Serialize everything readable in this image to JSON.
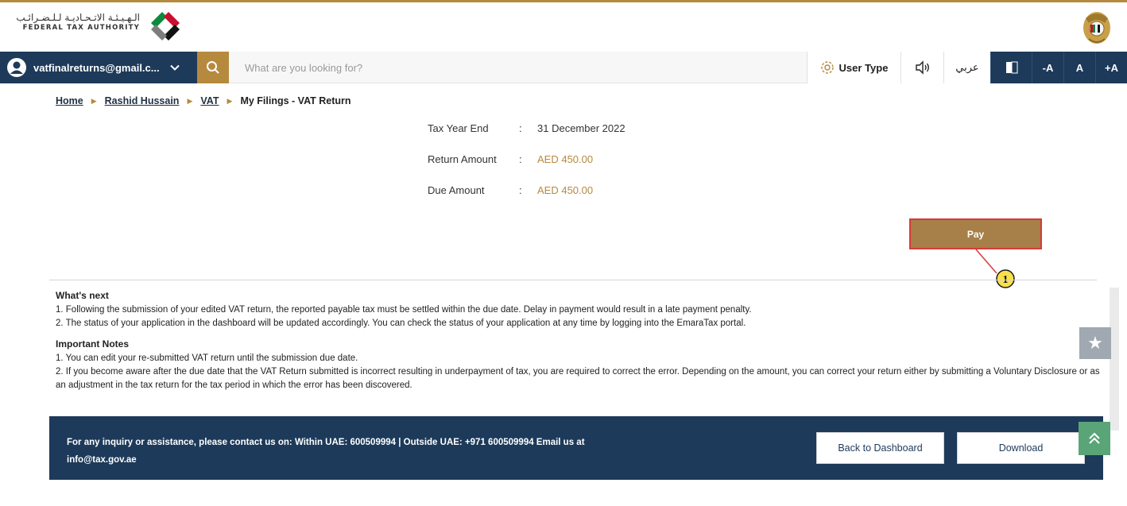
{
  "header": {
    "logo_arabic": "الـهـيـئـة الاتـحـاديـة لـلـضـرائـب",
    "logo_english": "FEDERAL TAX AUTHORITY",
    "emblem_icon": "uae-emblem-icon"
  },
  "navbar": {
    "user_email": "vatfinalreturns@gmail.c...",
    "search_placeholder": "What are you looking for?",
    "user_type_label": "User Type",
    "arabic_label": "عربي",
    "font_decrease": "-A",
    "font_normal": "A",
    "font_increase": "+A"
  },
  "breadcrumb": {
    "items": [
      "Home",
      "Rashid Hussain",
      "VAT"
    ],
    "current": "My Filings - VAT Return"
  },
  "summary": {
    "rows": [
      {
        "label": "Tax Year End",
        "colon": ":",
        "value": "31 December 2022"
      },
      {
        "label": "Return Amount",
        "colon": ":",
        "value": "AED 450.00"
      },
      {
        "label": "Due Amount",
        "colon": ":",
        "value": "AED 450.00"
      }
    ]
  },
  "pay": {
    "label": "Pay",
    "callout_number": "1"
  },
  "whats_next": {
    "title": "What's next",
    "items": [
      "1. Following the submission of your edited VAT return, the reported payable tax must be settled within the due date. Delay in payment would result in a late payment penalty.",
      "2. The status of your application in the dashboard will be updated accordingly. You can check the status of your application at any time by logging into the EmaraTax portal."
    ]
  },
  "important_notes": {
    "title": "Important Notes",
    "items": [
      "1. You can edit your re-submitted VAT return until the submission due date.",
      "2. If you become aware after the due date that the VAT Return submitted is incorrect resulting in underpayment of tax, you are required to correct the error. Depending on the amount, you can correct your return either by submitting a Voluntary Disclosure or as an adjustment in the tax return for the tax period in which the error has been discovered."
    ]
  },
  "footer": {
    "contact_line1": "For any inquiry or assistance, please contact us on: Within UAE: 600509994 | Outside UAE: +971 600509994 Email us at",
    "contact_line2": "info@tax.gov.ae",
    "back_label": "Back to Dashboard",
    "download_label": "Download"
  },
  "colors": {
    "gold": "#b68a3e",
    "navy": "#1d3a5a",
    "callout_red": "#d83a3a",
    "callout_yellow": "#f7e04a"
  }
}
